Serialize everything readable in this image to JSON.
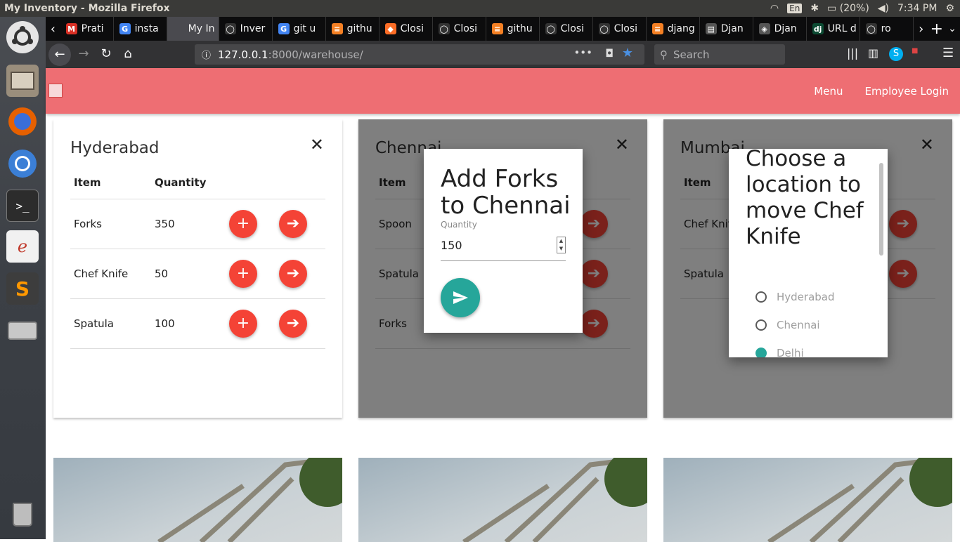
{
  "window": {
    "title": "My Inventory - Mozilla Firefox"
  },
  "tray": {
    "lang": "En",
    "battery": "(20%)",
    "time": "7:34 PM"
  },
  "tabs": [
    {
      "label": "Prati",
      "color": "#d93025",
      "glyph": "M"
    },
    {
      "label": "insta",
      "color": "#4285f4",
      "glyph": "G"
    },
    {
      "label": "My In",
      "color": "#4a4a4f",
      "glyph": ""
    },
    {
      "label": "Inver",
      "color": "#333",
      "glyph": "◯"
    },
    {
      "label": "git u",
      "color": "#4285f4",
      "glyph": "G"
    },
    {
      "label": "githu",
      "color": "#f48024",
      "glyph": "≡"
    },
    {
      "label": "Closi",
      "color": "#fc6d26",
      "glyph": "◆"
    },
    {
      "label": "Closi",
      "color": "#333",
      "glyph": "◯"
    },
    {
      "label": "githu",
      "color": "#f48024",
      "glyph": "≡"
    },
    {
      "label": "Closi",
      "color": "#333",
      "glyph": "◯"
    },
    {
      "label": "Closi",
      "color": "#333",
      "glyph": "◯"
    },
    {
      "label": "djang",
      "color": "#f48024",
      "glyph": "≡"
    },
    {
      "label": "Djan",
      "color": "#555",
      "glyph": "▤"
    },
    {
      "label": "Djan",
      "color": "#555",
      "glyph": "◈"
    },
    {
      "label": "URL d",
      "color": "#0c4b33",
      "glyph": "dj"
    },
    {
      "label": "ro",
      "color": "#333",
      "glyph": "◯"
    }
  ],
  "url": {
    "host": "127.0.0.1",
    "path": ":8000/warehouse/"
  },
  "search": {
    "placeholder": "Search"
  },
  "appnav": {
    "menu": "Menu",
    "login": "Employee Login"
  },
  "columns": {
    "item": "Item",
    "quantity": "Quantity"
  },
  "warehouses": [
    {
      "name": "Hyderabad",
      "rows": [
        {
          "item": "Forks",
          "qty": "350"
        },
        {
          "item": "Chef Knife",
          "qty": "50"
        },
        {
          "item": "Spatula",
          "qty": "100"
        }
      ]
    },
    {
      "name": "Chennai",
      "rows": [
        {
          "item": "Spoon",
          "qty": ""
        },
        {
          "item": "Spatula",
          "qty": ""
        },
        {
          "item": "Forks",
          "qty": ""
        }
      ]
    },
    {
      "name": "Mumbai",
      "rows": [
        {
          "item": "Chef Knife",
          "qty": ""
        },
        {
          "item": "Spatula",
          "qty": ""
        }
      ]
    }
  ],
  "add_modal": {
    "title": "Add Forks to Chennai",
    "qty_label": "Quantity",
    "qty_value": "150"
  },
  "move_modal": {
    "title": "Choose a location to move Chef Knife",
    "options": [
      {
        "label": "Hyderabad",
        "checked": false
      },
      {
        "label": "Chennai",
        "checked": false
      },
      {
        "label": "Delhi",
        "checked": true
      }
    ]
  },
  "icons": {
    "add": "plus-icon",
    "move": "arrow-right-icon",
    "close": "close-icon",
    "send": "send-icon"
  },
  "colors": {
    "nav": "#ee6e73",
    "fab": "#f44336",
    "teal": "#26a69a"
  }
}
